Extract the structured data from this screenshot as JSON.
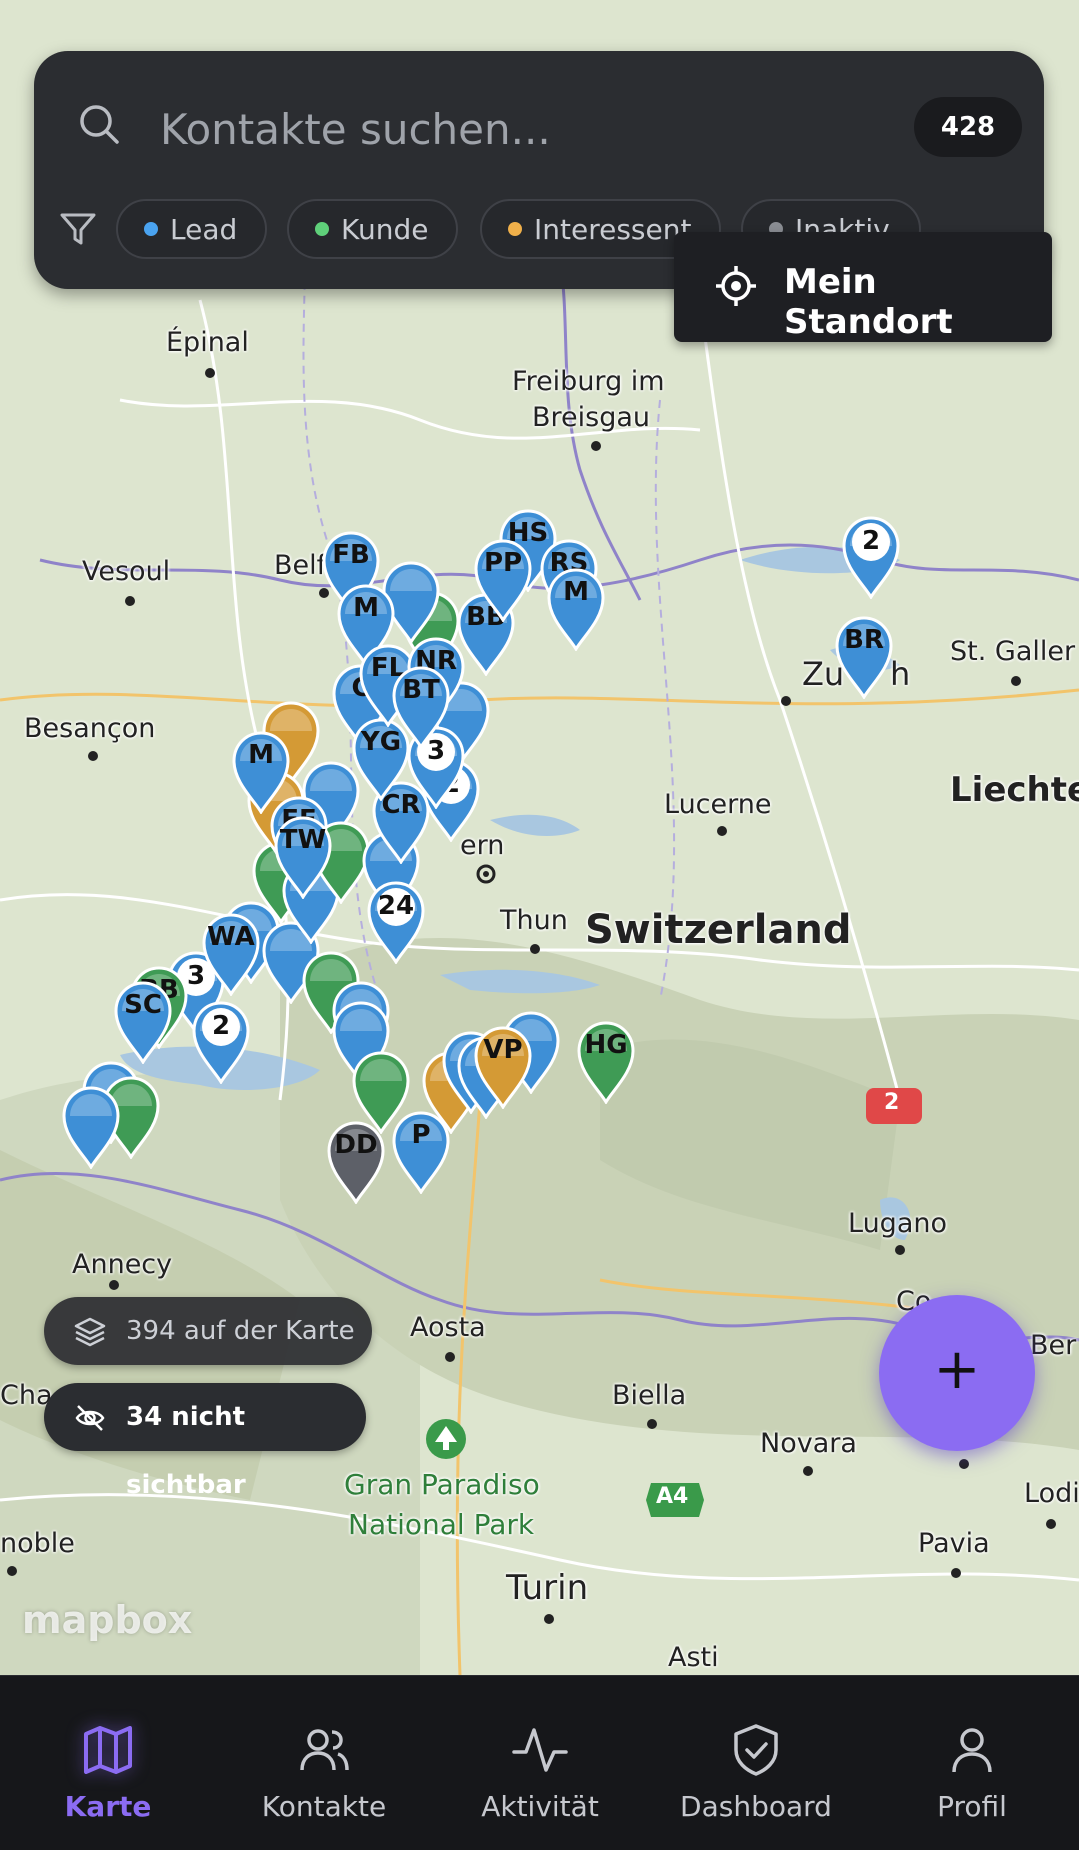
{
  "search": {
    "placeholder": "Kontakte suchen...",
    "count": "428"
  },
  "filters": [
    {
      "label": "Lead",
      "color": "#4aa3f0"
    },
    {
      "label": "Kunde",
      "color": "#5fd07a"
    },
    {
      "label": "Interessent",
      "color": "#f0b04a"
    },
    {
      "label": "Inaktiv",
      "color": "#8a8d93"
    }
  ],
  "location_button": "Mein Standort",
  "stats": {
    "on_map": "394 auf der Karte",
    "hidden": "34 nicht sichtbar"
  },
  "map": {
    "labels": [
      "Épinal",
      "Freiburg im",
      "Breisgau",
      "Vesoul",
      "Belf",
      "Besançon",
      "Zu",
      "h",
      "St. Galler",
      "Liechte",
      "Lucerne",
      "ern",
      "Thun",
      "Switzerland",
      "Annecy",
      "Aosta",
      "Biella",
      "Novara",
      "Lugano",
      "Co",
      "Ber",
      "Cha",
      "Gran Paradiso",
      "National Park",
      "noble",
      "Turin",
      "Pavia",
      "Asti",
      "Lodi"
    ],
    "road_shields": [
      "2",
      "A4"
    ],
    "attribution": "mapbox",
    "markers": [
      {
        "text": "2",
        "color": "#3e8fd6"
      },
      {
        "text": "BR",
        "color": "#3e8fd6"
      },
      {
        "text": "HG",
        "color": "#3f9b55"
      },
      {
        "text": "DD",
        "color": "#5d6068"
      },
      {
        "text": "P",
        "color": "#3e8fd6"
      },
      {
        "text": "3",
        "color": "#3e8fd6"
      },
      {
        "text": "2",
        "color": "#3e8fd6"
      },
      {
        "text": "2",
        "color": "#3e8fd6"
      },
      {
        "text": "FB",
        "color": "#3e8fd6"
      },
      {
        "text": "HS",
        "color": "#3e8fd6"
      },
      {
        "text": "RS",
        "color": "#3e8fd6"
      },
      {
        "text": "M",
        "color": "#3e8fd6"
      },
      {
        "text": "M",
        "color": "#3e8fd6"
      },
      {
        "text": "C",
        "color": "#3e8fd6"
      },
      {
        "text": "3",
        "color": "#3e8fd6"
      },
      {
        "text": "BB",
        "color": "#3f9b55"
      },
      {
        "text": "SC",
        "color": "#3e8fd6"
      },
      {
        "text": "WA",
        "color": "#3e8fd6"
      },
      {
        "text": "24",
        "color": "#3e8fd6"
      },
      {
        "text": "CR",
        "color": "#3e8fd6"
      },
      {
        "text": "FF",
        "color": "#3e8fd6"
      },
      {
        "text": "TW",
        "color": "#3e8fd6"
      },
      {
        "text": "VP",
        "color": "#d49a35"
      },
      {
        "text": "M",
        "color": "#3e8fd6"
      },
      {
        "text": "YG",
        "color": "#3e8fd6"
      },
      {
        "text": "FL",
        "color": "#3e8fd6"
      },
      {
        "text": "NR",
        "color": "#3e8fd6"
      },
      {
        "text": "BT",
        "color": "#3e8fd6"
      },
      {
        "text": "BB",
        "color": "#3e8fd6"
      },
      {
        "text": "PP",
        "color": "#3e8fd6"
      }
    ]
  },
  "nav": [
    {
      "label": "Karte",
      "active": true
    },
    {
      "label": "Kontakte",
      "active": false
    },
    {
      "label": "Aktivität",
      "active": false
    },
    {
      "label": "Dashboard",
      "active": false
    },
    {
      "label": "Profil",
      "active": false
    }
  ],
  "colors": {
    "accent": "#8b6cf2",
    "panel": "#2b2d31",
    "nav_bg": "#16171a"
  }
}
